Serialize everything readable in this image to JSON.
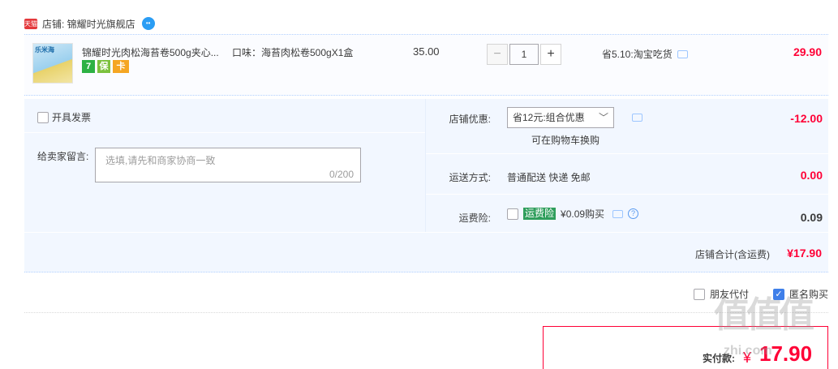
{
  "shop": {
    "badge": "天猫",
    "label": "店铺: 锦耀时光旗舰店",
    "contact_icon": "wangwang-icon"
  },
  "item": {
    "thumb_text": "乐米海",
    "title": "锦耀时光肉松海苔卷500g夹心...",
    "badges": [
      "7",
      "保",
      "卡"
    ],
    "flavor": "口味：海苔肉松卷500gX1盒",
    "unit_price": "35.00",
    "quantity": "1",
    "minus_label": "−",
    "plus_label": "+",
    "saving": "省5.10:淘宝吃货",
    "total": "29.90"
  },
  "invoice": {
    "label": "开具发票"
  },
  "message": {
    "label": "给卖家留言:",
    "placeholder": "选填,请先和商家协商一致",
    "count": "0/200"
  },
  "promo": {
    "label": "店铺优惠:",
    "selected": "省12元:组合优惠",
    "sub": "可在购物车换购",
    "amount": "-12.00"
  },
  "shipping": {
    "label": "运送方式:",
    "text": "普通配送 快递 免邮",
    "amount": "0.00"
  },
  "insurance": {
    "label": "运费险:",
    "tag": "运费险",
    "text": "¥0.09购买",
    "amount": "0.09"
  },
  "shop_total": {
    "label": "店铺合计(含运费)",
    "value": "¥17.90"
  },
  "options": {
    "friend_pay": "朋友代付",
    "anonymous": "匿名购买"
  },
  "payment": {
    "label": "实付款:",
    "currency": "¥",
    "value": "17.90"
  },
  "watermark": {
    "text": "值值值",
    "url": "zhi.com"
  },
  "colors": {
    "price_red": "#ff0036",
    "panel_bg": "#f2f7ff",
    "border_blue": "#b2d1ff",
    "check_blue": "#3f7fe9"
  }
}
